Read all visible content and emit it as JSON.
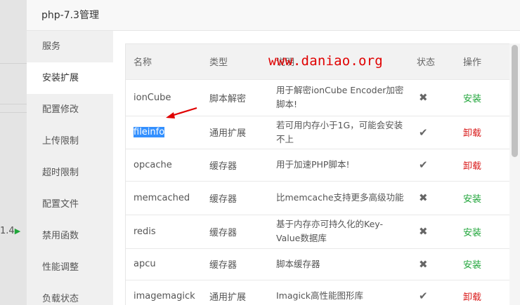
{
  "modal": {
    "title": "php-7.3管理"
  },
  "sidebar": {
    "items": [
      {
        "label": "服务"
      },
      {
        "label": "安装扩展"
      },
      {
        "label": "配置修改"
      },
      {
        "label": "上传限制"
      },
      {
        "label": "超时限制"
      },
      {
        "label": "配置文件"
      },
      {
        "label": "禁用函数"
      },
      {
        "label": "性能调整"
      },
      {
        "label": "负载状态"
      }
    ]
  },
  "background": {
    "fragment": "1.4"
  },
  "watermark": "www.daniao.org",
  "table": {
    "headers": {
      "name": "名称",
      "type": "类型",
      "desc": "说明",
      "status": "状态",
      "action": "操作"
    },
    "rows": [
      {
        "name": "ionCube",
        "type": "脚本解密",
        "desc": "用于解密ionCube Encoder加密脚本!",
        "status": "not-installed",
        "action": "安装"
      },
      {
        "name": "fileinfo",
        "type": "通用扩展",
        "desc": "若可用内存小于1G，可能会安装不上",
        "status": "installed",
        "action": "卸载"
      },
      {
        "name": "opcache",
        "type": "缓存器",
        "desc": "用于加速PHP脚本!",
        "status": "installed",
        "action": "卸载"
      },
      {
        "name": "memcached",
        "type": "缓存器",
        "desc": "比memcache支持更多高级功能",
        "status": "not-installed",
        "action": "安装"
      },
      {
        "name": "redis",
        "type": "缓存器",
        "desc": "基于内存亦可持久化的Key-Value数据库",
        "status": "not-installed",
        "action": "安装"
      },
      {
        "name": "apcu",
        "type": "缓存器",
        "desc": "脚本缓存器",
        "status": "not-installed",
        "action": "安装"
      },
      {
        "name": "imagemagick",
        "type": "通用扩展",
        "desc": "Imagick高性能图形库",
        "status": "installed",
        "action": "卸载"
      }
    ]
  },
  "icons": {
    "installed": "check-icon",
    "not-installed": "cross-icon"
  },
  "colors": {
    "install": "#20a53a",
    "uninstall": "#d91b1b",
    "watermark": "#e00000",
    "selection": "#3390ff"
  }
}
